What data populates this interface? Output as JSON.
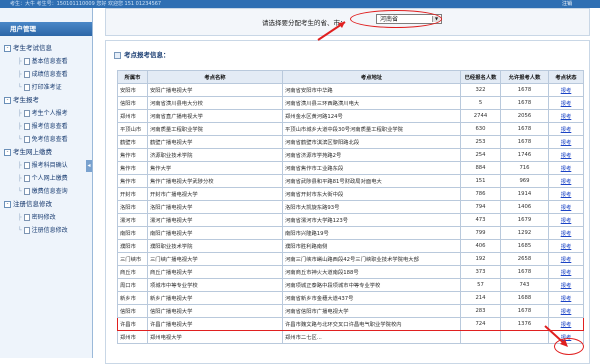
{
  "header": {
    "user_text": "考生：大牛 考生号：150101110009 您好 欢迎您 151 01234567",
    "exit_label": "注销"
  },
  "sidebar": {
    "title": "用户管理",
    "groups": [
      {
        "label": "考生考试信息",
        "items": [
          "基本信息查看",
          "成绩信息查看",
          "打印准考证"
        ]
      },
      {
        "label": "考生报考",
        "items": [
          "考生个人报考",
          "报考信息查看",
          "免考信息查看"
        ]
      },
      {
        "label": "考生网上缴费",
        "items": [
          "报考科目确认",
          "个人网上缴费",
          "缴费信息查询"
        ]
      },
      {
        "label": "注册信息修改",
        "items": [
          "密码修改",
          "注册信息修改"
        ]
      }
    ]
  },
  "selector": {
    "label": "请选择要分配考生的省、市：",
    "value": "河南省"
  },
  "panel": {
    "title": "考点报考信息："
  },
  "table": {
    "headers": [
      "所属市",
      "考点名称",
      "考点地址",
      "已经报名人数",
      "允许报考人数",
      "考点状态"
    ],
    "rows": [
      [
        "安阳市",
        "安阳广播电视大学",
        "河南省安阳市中华路",
        "322",
        "1678",
        "报考"
      ],
      [
        "信阳市",
        "河南省潢川县电大分校",
        "河南省潢川县三环西路潢川电大",
        "5",
        "1678",
        "报考"
      ],
      [
        "郑州市",
        "河南省直广播电视大学",
        "郑州金水区黄河路124号",
        "2744",
        "2056",
        "报考"
      ],
      [
        "平顶山市",
        "河南质量工程职业学院",
        "平顶山市城乡大道中段30号河南质量工程职业学院",
        "630",
        "1678",
        "报考"
      ],
      [
        "鹤壁市",
        "鹤壁广播电视大学",
        "河南省鹤壁市淇滨区黎阳路北段",
        "253",
        "1678",
        "报考"
      ],
      [
        "焦作市",
        "济源职业技术学院",
        "河南省济源市学苑路2号",
        "254",
        "1746",
        "报考"
      ],
      [
        "焦作市",
        "焦作大学",
        "河南省焦作市工业路东段",
        "884",
        "716",
        "报考"
      ],
      [
        "焦作市",
        "焦作广播电视大学武陟分校",
        "河南省武陟县和平路81号财政局对面电大",
        "151",
        "969",
        "报考"
      ],
      [
        "开封市",
        "开封市广播电视大学",
        "河南省开封市东大街中段",
        "786",
        "1914",
        "报考"
      ],
      [
        "洛阳市",
        "洛阳广播电视大学",
        "洛阳市大凯旋东路93号",
        "794",
        "1406",
        "报考"
      ],
      [
        "漯河市",
        "漯河广播电视大学",
        "河南省漯河市大学路123号",
        "473",
        "1679",
        "报考"
      ],
      [
        "南阳市",
        "南阳广播电视大学",
        "南阳市兴隆路19号",
        "799",
        "1292",
        "报考"
      ],
      [
        "濮阳市",
        "濮阳职业技术学院",
        "濮阳市胜利路南侧",
        "406",
        "1685",
        "报考"
      ],
      [
        "三门峡市",
        "三门峡广播电视大学",
        "河南三门峡市崤山路西段42号三门峡职业技术学院电大部",
        "192",
        "2658",
        "报考"
      ],
      [
        "商丘市",
        "商丘广播电视大学",
        "河南商丘市神火大道南段188号",
        "373",
        "1678",
        "报考"
      ],
      [
        "周口市",
        "项城市中等专业学校",
        "河南项城正泰路中段项城市中等专业学校",
        "57",
        "743",
        "报考"
      ],
      [
        "新乡市",
        "新乡广播电视大学",
        "河南省新乡市金穗大道437号",
        "214",
        "1688",
        "报考"
      ],
      [
        "信阳市",
        "信阳广播电视大学",
        "河南省信阳市广播电视大学",
        "283",
        "1678",
        "报考"
      ],
      [
        "许昌市",
        "许昌广播电视大学",
        "许昌市魏文路与北环交叉口许昌电气职业学院校内",
        "724",
        "1376",
        "报考"
      ],
      [
        "郑州市",
        "郑州电视大学",
        "郑州市二七区...",
        "",
        "",
        "报考"
      ]
    ]
  },
  "colors": {
    "sidebar_header": "#2c66a7",
    "table_header": "#e3ebf5",
    "link": "#1b44c6",
    "annotation": "#e02020"
  },
  "icons": [
    "folder-box-icon",
    "document-icon",
    "dropdown-arrow-icon",
    "collapse-toggle-icon"
  ]
}
